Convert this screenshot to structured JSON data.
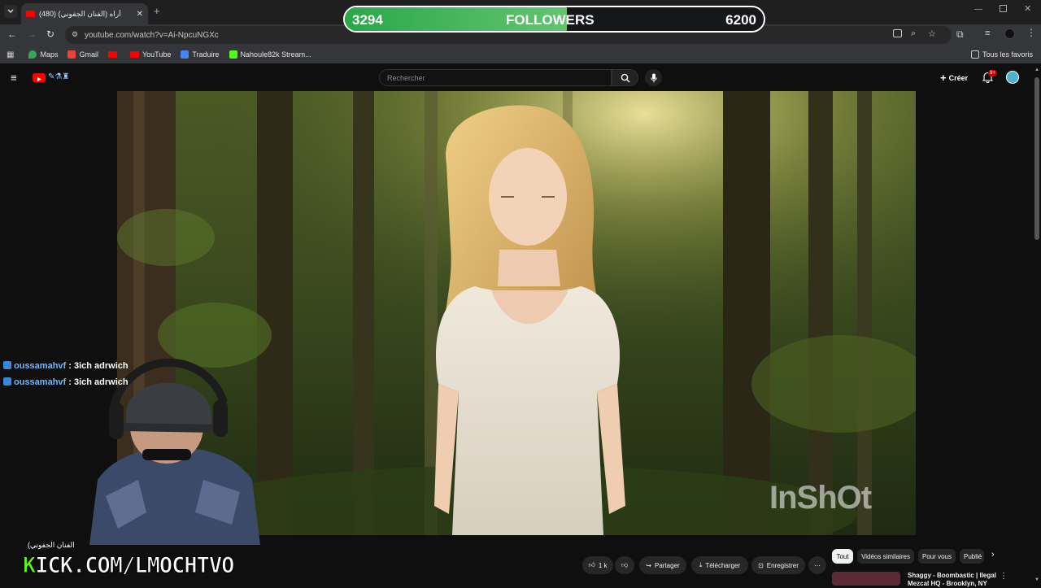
{
  "browser": {
    "tab_title": "(480) أراه (الفنان الجفوني)",
    "address": "youtube.com/watch?v=Ai-NpcuNGXc",
    "bookmarks": [
      "Maps",
      "Gmail",
      "YouTube",
      "Traduire",
      "Nahoule82k Stream..."
    ],
    "all_bookmarks": "Tous les favoris"
  },
  "youtube": {
    "search_placeholder": "Rechercher",
    "create_label": "Créer",
    "notif_badge": "9+",
    "actions": {
      "likes": "1 k",
      "share": "Partager",
      "download": "Télécharger",
      "save": "Enregistrer"
    },
    "chips": [
      "Tout",
      "Vidéos similaires",
      "Pour vous",
      "Publié"
    ],
    "next_video": {
      "title_line1": "Shaggy - Boombastic | Ilegal",
      "title_line2": "Mezcal HQ - Brooklyn, NY"
    },
    "watermark": "InShOt"
  },
  "overlay": {
    "followers_label": "FOLLOWERS",
    "followers_current": "3294",
    "followers_goal": "6200",
    "progress": 0.531,
    "chat": [
      {
        "user": "oussamahvf",
        "message": ": 3ich adrwich"
      },
      {
        "user": "oussamahvf",
        "message": ": 3ich adrwich"
      }
    ],
    "kick_url_k": "K",
    "kick_url_rest": "ICK.COM/LMOCHTVO",
    "streamer_name": "(الفنان الجفوني"
  },
  "colors": {
    "kick_green": "#53fc18",
    "progress_green": "#3fb55a",
    "yt_red": "#ff0000",
    "chat_user": "#6cb8ff"
  }
}
